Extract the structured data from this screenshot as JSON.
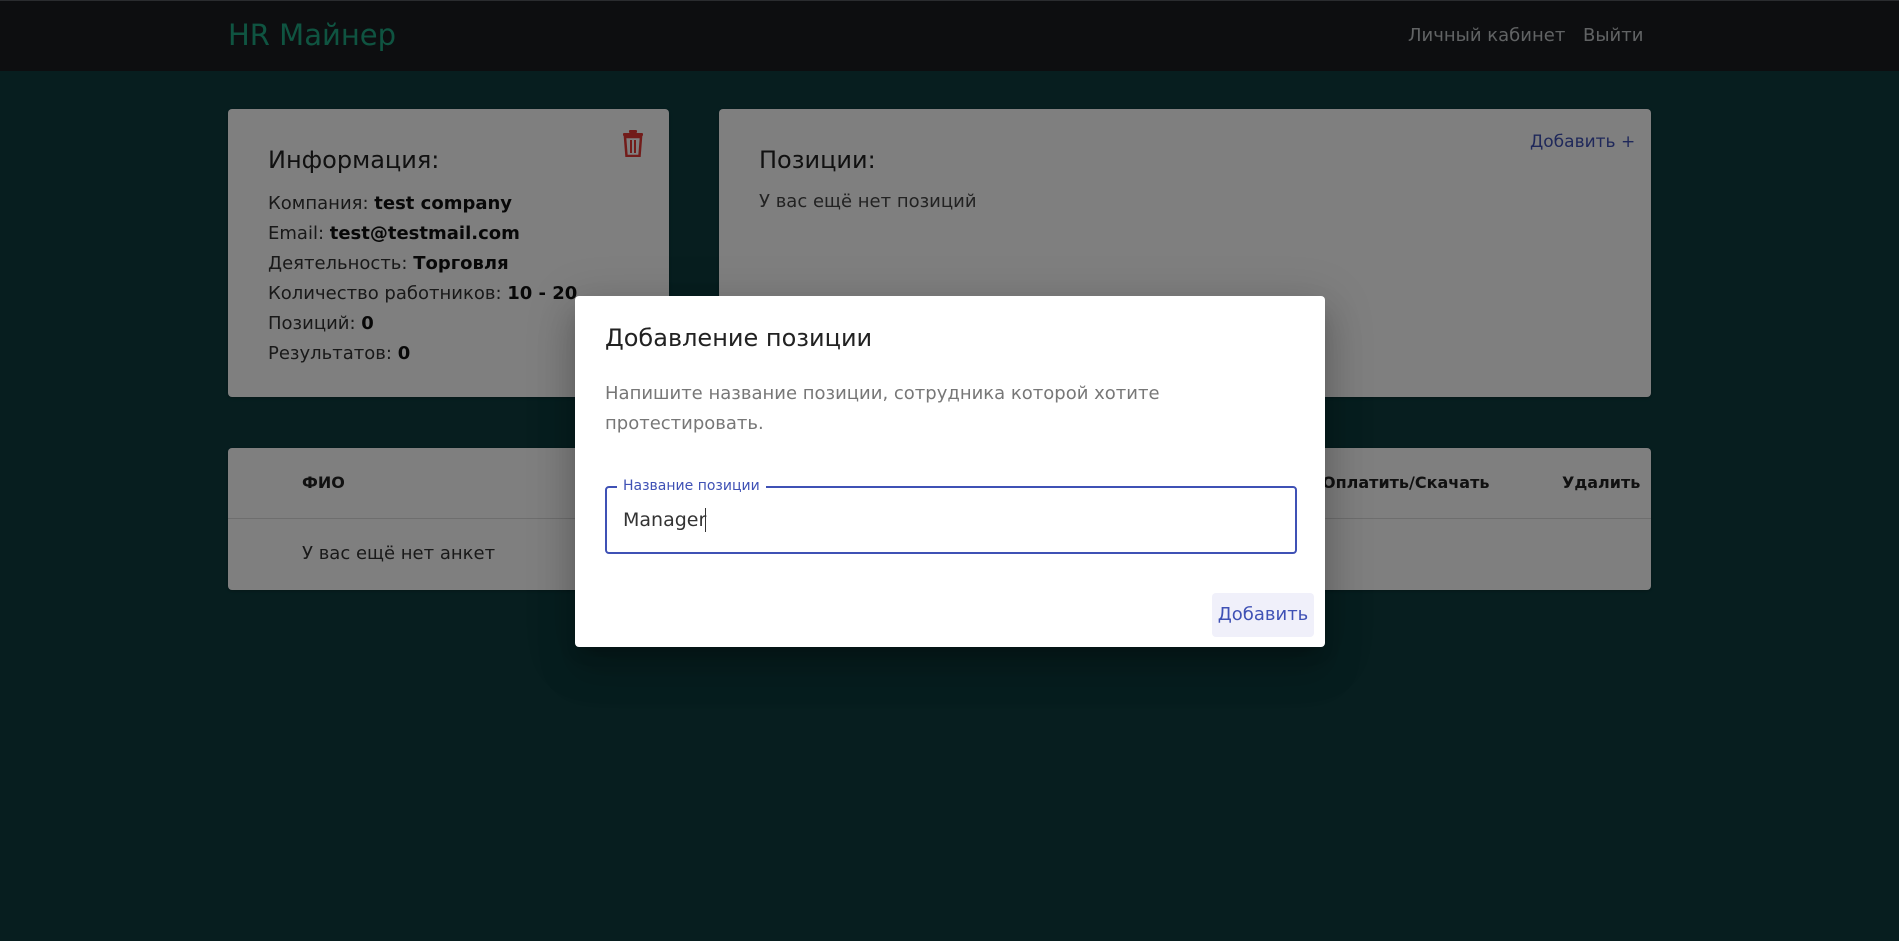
{
  "header": {
    "brand": "HR Майнер",
    "nav": {
      "account": "Личный кабинет",
      "logout": "Выйти"
    }
  },
  "info": {
    "title": "Информация:",
    "rows": [
      {
        "label": "Компания: ",
        "value": "test company"
      },
      {
        "label": "Email: ",
        "value": "test@testmail.com"
      },
      {
        "label": "Деятельность: ",
        "value": "Торговля"
      },
      {
        "label": "Количество работников: ",
        "value": "10 - 20"
      },
      {
        "label": "Позиций: ",
        "value": "0"
      },
      {
        "label": "Результатов: ",
        "value": "0"
      }
    ],
    "delete_icon": "trash-icon",
    "delete_color": "#e53935"
  },
  "positions": {
    "title": "Позиции:",
    "add_label": "Добавить +",
    "empty_text": "У вас ещё нет позиций"
  },
  "table": {
    "columns": [
      "ФИО",
      "Оплатить/Скачать",
      "Удалить"
    ],
    "empty_text": "У вас ещё нет анкет"
  },
  "dialog": {
    "title": "Добавление позиции",
    "text": "Напишите название позиции, сотрудника которой хотите протестировать.",
    "field_label": "Название позиции",
    "field_value": "Manager",
    "submit_label": "Добавить"
  },
  "colors": {
    "background": "#0e3d3f",
    "topbar": "#1a1d21",
    "brand": "#1fa882",
    "accent": "#3f51b5"
  }
}
